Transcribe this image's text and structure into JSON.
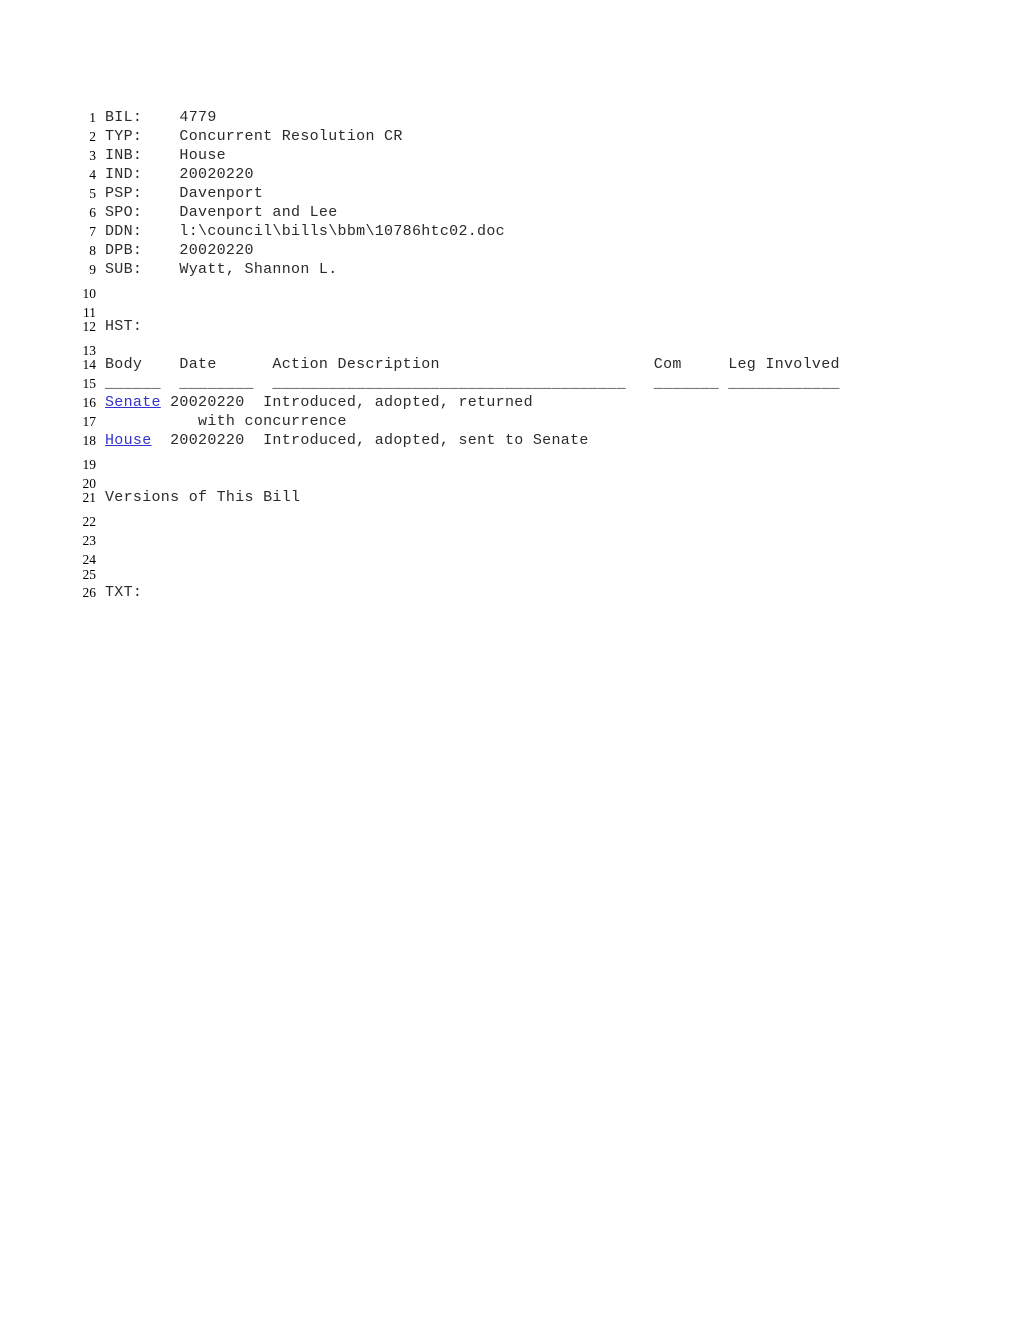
{
  "document": {
    "type": "legislative-bill-record",
    "background_color": "#ffffff",
    "text_color": "#2b2b2b",
    "link_color": "#3333cc"
  },
  "fields": [
    {
      "line": 1,
      "label": "BIL:",
      "value": "4779"
    },
    {
      "line": 2,
      "label": "TYP:",
      "value": "Concurrent Resolution CR"
    },
    {
      "line": 3,
      "label": "INB:",
      "value": "House"
    },
    {
      "line": 4,
      "label": "IND:",
      "value": "20020220"
    },
    {
      "line": 5,
      "label": "PSP:",
      "value": "Davenport"
    },
    {
      "line": 6,
      "label": "SPO:",
      "value": "Davenport and Lee"
    },
    {
      "line": 7,
      "label": "DDN:",
      "value": "l:\\council\\bills\\bbm\\10786htc02.doc"
    },
    {
      "line": 8,
      "label": "DPB:",
      "value": "20020220"
    },
    {
      "line": 9,
      "label": "SUB:",
      "value": "Wyatt, Shannon L."
    }
  ],
  "lines": {
    "l1": "BIL:    4779",
    "l2": "TYP:    Concurrent Resolution CR",
    "l3": "INB:    House",
    "l4": "IND:    20020220",
    "l5": "PSP:    Davenport",
    "l6": "SPO:    Davenport and Lee",
    "l7": "DDN:    l:\\council\\bills\\bbm\\10786htc02.doc",
    "l8": "DPB:    20020220",
    "l9": "SUB:    Wyatt, Shannon L.",
    "l12": "HST:",
    "l14": "Body    Date      Action Description                       Com     Leg Involved",
    "l15": "______  ________  ______________________________________   _______ ____________",
    "l16_date_action": " 20020220  Introduced, adopted, returned",
    "l17": "          with concurrence",
    "l18_date_action": "  20020220  Introduced, adopted, sent to Senate",
    "l21": "Versions of This Bill",
    "l26": "TXT:"
  },
  "history_table": {
    "section_label": "HST:",
    "headers": [
      "Body",
      "Date",
      "Action Description",
      "Com",
      "Leg Involved"
    ],
    "rows": [
      {
        "body": "Senate",
        "body_is_link": true,
        "date": "20020220",
        "action": "Introduced, adopted, returned",
        "action_continued": "with concurrence",
        "com": "",
        "leg_involved": ""
      },
      {
        "body": "House",
        "body_is_link": true,
        "date": "20020220",
        "action": "Introduced, adopted, sent to Senate",
        "com": "",
        "leg_involved": ""
      }
    ]
  },
  "links": {
    "senate": "Senate",
    "house": "House"
  },
  "sections": {
    "versions": "Versions of This Bill",
    "text": "TXT:"
  },
  "line_numbers": [
    "1",
    "2",
    "3",
    "4",
    "5",
    "6",
    "7",
    "8",
    "9",
    "10",
    "11",
    "12",
    "13",
    "14",
    "15",
    "16",
    "17",
    "18",
    "19",
    "20",
    "21",
    "22",
    "23",
    "24",
    "25",
    "26"
  ]
}
